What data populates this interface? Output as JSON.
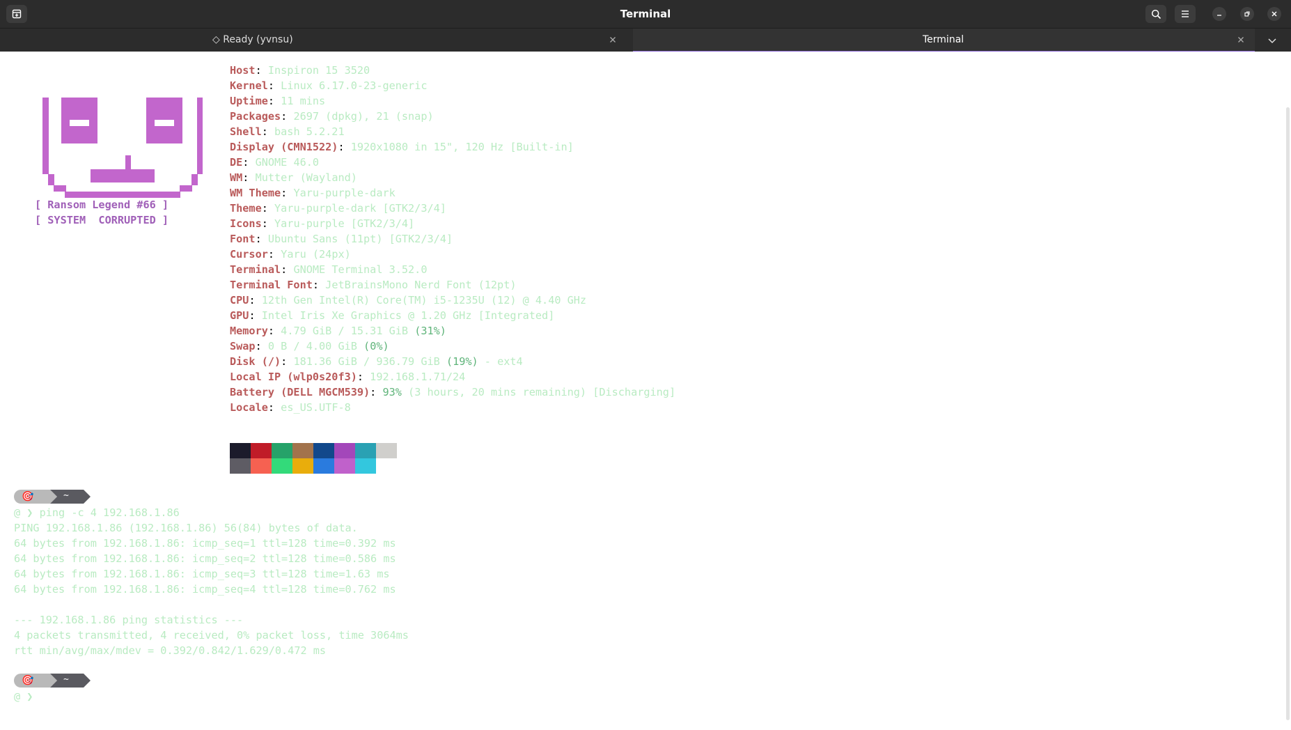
{
  "window": {
    "title": "Terminal"
  },
  "tabs": [
    {
      "label": "◇ Ready (yvnsu)",
      "active": false
    },
    {
      "label": "Terminal",
      "active": true
    }
  ],
  "ascii_art": {
    "color": "#c266cc",
    "line1": "[ Ransom Legend #66 ]",
    "line2": "[ SYSTEM  CORRUPTED ]"
  },
  "sysinfo": [
    {
      "key": "Host",
      "value": "Inspiron 15 3520"
    },
    {
      "key": "Kernel",
      "value": "Linux 6.17.0-23-generic"
    },
    {
      "key": "Uptime",
      "value": "11 mins"
    },
    {
      "key": "Packages",
      "value": "2697 (dpkg), 21 (snap)"
    },
    {
      "key": "Shell",
      "value": "bash 5.2.21"
    },
    {
      "key": "Display (CMN1522)",
      "value": "1920x1080 in 15\", 120 Hz [Built-in]"
    },
    {
      "key": "DE",
      "value": "GNOME 46.0"
    },
    {
      "key": "WM",
      "value": "Mutter (Wayland)"
    },
    {
      "key": "WM Theme",
      "value": "Yaru-purple-dark"
    },
    {
      "key": "Theme",
      "value": "Yaru-purple-dark [GTK2/3/4]"
    },
    {
      "key": "Icons",
      "value": "Yaru-purple [GTK2/3/4]"
    },
    {
      "key": "Font",
      "value": "Ubuntu Sans (11pt) [GTK2/3/4]"
    },
    {
      "key": "Cursor",
      "value": "Yaru (24px)"
    },
    {
      "key": "Terminal",
      "value": "GNOME Terminal 3.52.0"
    },
    {
      "key": "Terminal Font",
      "value": "JetBrainsMono Nerd Font (12pt)"
    },
    {
      "key": "CPU",
      "value": "12th Gen Intel(R) Core(TM) i5-1235U (12) @ 4.40 GHz"
    },
    {
      "key": "GPU",
      "value": "Intel Iris Xe Graphics @ 1.20 GHz [Integrated]"
    },
    {
      "key": "Memory",
      "value": "4.79 GiB / 15.31 GiB",
      "highlight": "(31%)"
    },
    {
      "key": "Swap",
      "value": "0 B / 4.00 GiB",
      "highlight": "(0%)"
    },
    {
      "key": "Disk (/)",
      "value": "181.36 GiB / 936.79 GiB",
      "highlight": "(19%)",
      "suffix": " - ext4"
    },
    {
      "key": "Local IP (wlp0s20f3)",
      "value": "192.168.1.71/24"
    },
    {
      "key": "Battery (DELL MGCM539)",
      "highlight": "93%",
      "suffix": " (3 hours, 20 mins remaining) [Discharging]"
    },
    {
      "key": "Locale",
      "value": "es_US.UTF-8"
    }
  ],
  "palette": {
    "row1": [
      "#1c1b2b",
      "#c01c28",
      "#26a269",
      "#a2734c",
      "#12488b",
      "#a347ba",
      "#2aa1b3",
      "#d0cfcc"
    ],
    "row2": [
      "#5e5c64",
      "#f66151",
      "#33da7a",
      "#e9ad0c",
      "#2a7bde",
      "#c061cb",
      "#33c7de"
    ]
  },
  "prompt": {
    "icon": "🎯",
    "dir": "~",
    "symbol": "❯"
  },
  "session": {
    "command": "ping -c 4 192.168.1.86",
    "output": [
      "PING 192.168.1.86 (192.168.1.86) 56(84) bytes of data.",
      "64 bytes from 192.168.1.86: icmp_seq=1 ttl=128 time=0.392 ms",
      "64 bytes from 192.168.1.86: icmp_seq=2 ttl=128 time=0.586 ms",
      "64 bytes from 192.168.1.86: icmp_seq=3 ttl=128 time=1.63 ms",
      "64 bytes from 192.168.1.86: icmp_seq=4 ttl=128 time=0.762 ms",
      "",
      "--- 192.168.1.86 ping statistics ---",
      "4 packets transmitted, 4 received, 0% packet loss, time 3064ms",
      "rtt min/avg/max/mdev = 0.392/0.842/1.629/0.472 ms"
    ]
  }
}
